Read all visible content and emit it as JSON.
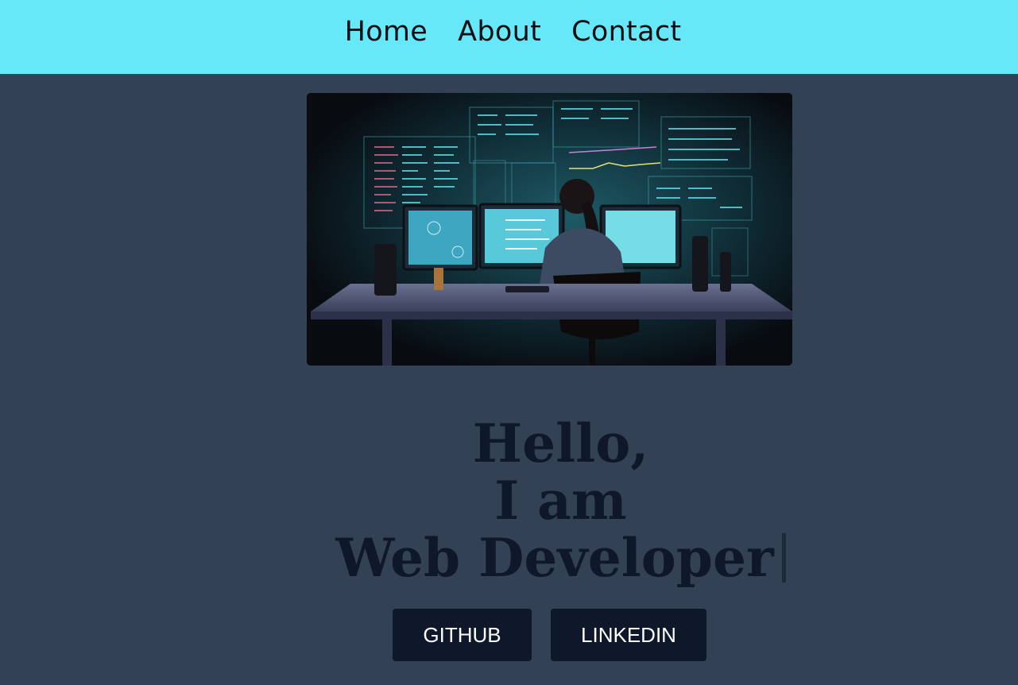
{
  "nav": {
    "items": [
      {
        "label": "Home"
      },
      {
        "label": "About"
      },
      {
        "label": "Contact"
      }
    ]
  },
  "hero": {
    "image": {
      "icon": "developer-at-desk-illustration"
    },
    "headline": {
      "line1": "Hello,",
      "line2": "I am",
      "line3": "Web Developer"
    }
  },
  "buttons": {
    "github_label": "GITHUB",
    "linkedin_label": "LINKEDIN"
  },
  "colors": {
    "nav_background": "#67e8f9",
    "page_background": "#334155",
    "headline_text": "#0f172a",
    "button_background": "#0f172a",
    "button_text": "#ffffff"
  }
}
